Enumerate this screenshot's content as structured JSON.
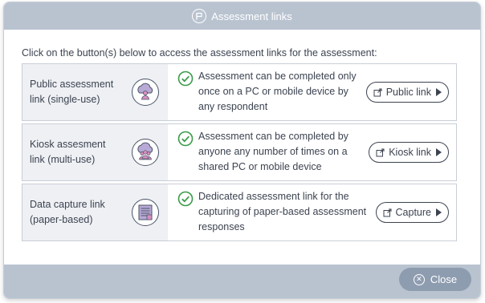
{
  "dialog": {
    "title": "Assessment links",
    "title_icon": "flag-icon",
    "intro": "Click on the button(s) below to access the assessment links for the assessment:",
    "rows": [
      {
        "label": "Public assessment link (single-use)",
        "icon": "single-user-cloud-icon",
        "description": "Assessment can be completed only once on a PC or mobile device by any respondent",
        "button": "Public link"
      },
      {
        "label": "Kiosk assesment link (multi-use)",
        "icon": "multi-user-cloud-icon",
        "description": "Assessment can be completed by anyone any number of times on a shared PC or mobile device",
        "button": "Kiosk link"
      },
      {
        "label": "Data capture link (paper-based)",
        "icon": "paper-form-icon",
        "description": "Dedicated assessment link for the capturing of paper-based assessment responses",
        "button": "Capture"
      }
    ],
    "close_label": "Close"
  },
  "colors": {
    "header_footer": "#b9c3d0",
    "close_button": "#8e9cb0",
    "check_green": "#3b9b4a",
    "user_pink": "#d98fc0",
    "cloud_lavender": "#b8a9d6"
  }
}
